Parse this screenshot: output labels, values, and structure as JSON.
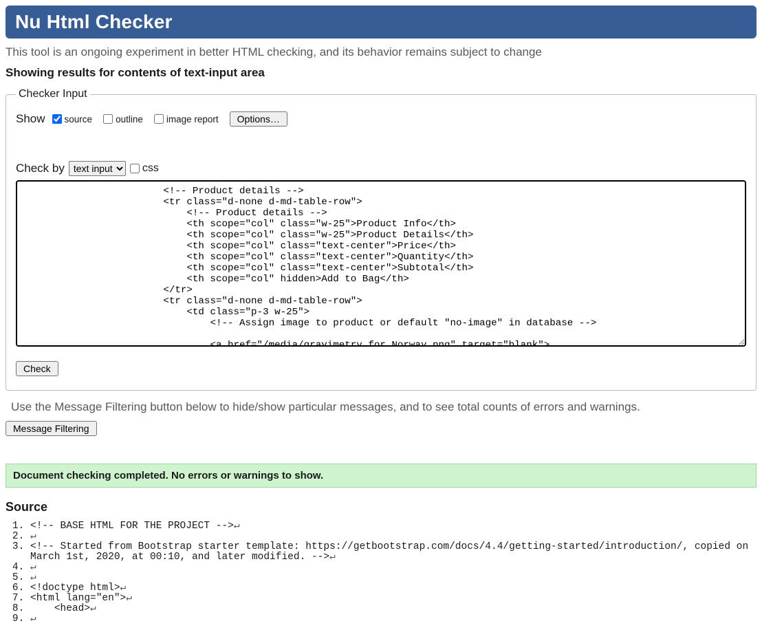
{
  "banner": {
    "title": "Nu Html Checker"
  },
  "intro": "This tool is an ongoing experiment in better HTML checking, and its behavior remains subject to change",
  "results_for": "Showing results for contents of text-input area",
  "checker": {
    "legend": "Checker Input",
    "show_label": "Show",
    "source_label": "source",
    "outline_label": "outline",
    "image_report_label": "image report",
    "options_btn": "Options…",
    "check_by_label": "Check by",
    "check_by_value": "text input",
    "css_label": "css",
    "textarea_value": "                        <!-- Product details -->\n                        <tr class=\"d-none d-md-table-row\">\n                            <!-- Product details -->\n                            <th scope=\"col\" class=\"w-25\">Product Info</th>\n                            <th scope=\"col\" class=\"w-25\">Product Details</th>\n                            <th scope=\"col\" class=\"text-center\">Price</th>\n                            <th scope=\"col\" class=\"text-center\">Quantity</th>\n                            <th scope=\"col\" class=\"text-center\">Subtotal</th>\n                            <th scope=\"col\" hidden>Add to Bag</th>\n                        </tr>\n                        <tr class=\"d-none d-md-table-row\">\n                            <td class=\"p-3 w-25\">\n                                <!-- Assign image to product or default \"no-image\" in database -->\n                                \n                                <a href=\"/media/gravimetry_for_Norway.png\" target=\"blank\">",
    "check_btn": "Check"
  },
  "filter": {
    "message": "Use the Message Filtering button below to hide/show particular messages, and to see total counts of errors and warnings.",
    "btn": "Message Filtering"
  },
  "success": "Document checking completed. No errors or warnings to show.",
  "source_heading": "Source",
  "source_lines": [
    "<!-- BASE HTML FOR THE PROJECT -->",
    "",
    "<!-- Started from Bootstrap starter template: https://getbootstrap.com/docs/4.4/getting-started/introduction/, copied on March 1st, 2020, at 00:10, and later modified. -->",
    "",
    "",
    "<!doctype html>",
    "<html lang=\"en\">",
    "    <head>",
    ""
  ]
}
